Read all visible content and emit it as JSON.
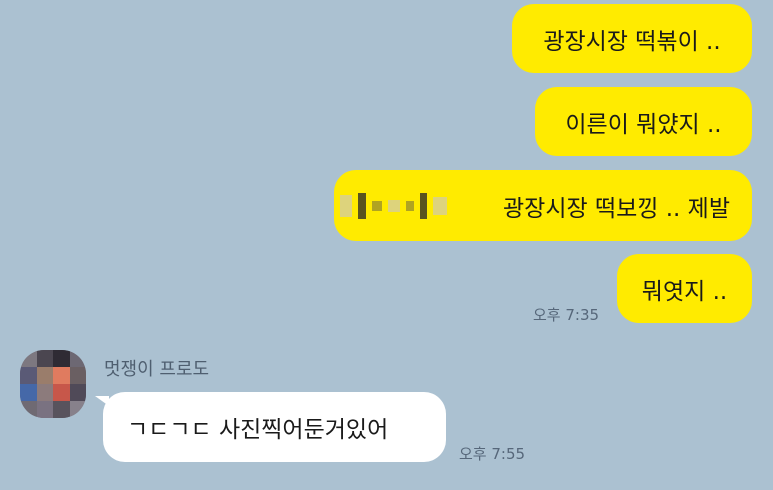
{
  "conversation": {
    "messages": [
      {
        "side": "mine",
        "text": "광장시장 떡볶이 .."
      },
      {
        "side": "mine",
        "text": "이른이 뭐얐지 .."
      },
      {
        "side": "mine",
        "text": "광장시장 떡보낑 .. 제발",
        "obscured_prefix": true
      },
      {
        "side": "mine",
        "text": "뭐엿지 ..",
        "time": "오후 7:35"
      },
      {
        "side": "theirs",
        "sender": "멋쟁이 프로도",
        "text": "ㄱㄷㄱㄷ 사진찍어둔거있어",
        "time": "오후 7:55"
      }
    ]
  },
  "colors": {
    "background": "#abc1d1",
    "my_bubble": "#ffeb00",
    "their_bubble": "#ffffff",
    "timestamp": "#56677a"
  }
}
